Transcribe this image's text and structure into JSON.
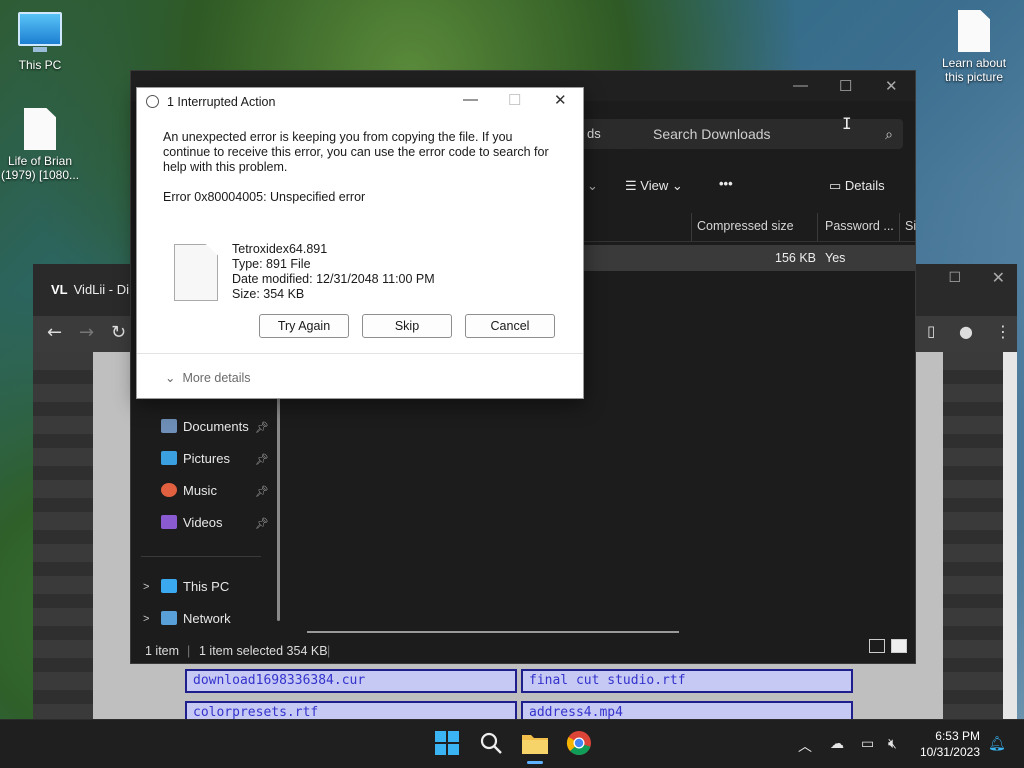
{
  "desktop": {
    "icons": [
      {
        "label": "This PC"
      },
      {
        "label": "Life of Brian (1979) [1080..."
      },
      {
        "label": "Learn about this picture"
      }
    ]
  },
  "explorer": {
    "address_fragment": "ds",
    "search_placeholder": "Search Downloads",
    "toolbar": {
      "view": "View",
      "more": "•••",
      "details": "Details"
    },
    "columns": [
      "Compressed size",
      "Password ...",
      "Si"
    ],
    "row": {
      "compressed_size": "156 KB",
      "password": "Yes"
    },
    "nav": [
      {
        "label": "Documents",
        "pinned": true
      },
      {
        "label": "Pictures",
        "pinned": true
      },
      {
        "label": "Music",
        "pinned": true
      },
      {
        "label": "Videos",
        "pinned": true
      },
      {
        "label": "This PC"
      },
      {
        "label": "Network"
      }
    ],
    "status": {
      "count": "1 item",
      "selected": "1 item selected  354 KB"
    }
  },
  "browser": {
    "tab_title": "VidLii - Di",
    "logo": "VL",
    "cells": [
      "download1698336384.cur",
      "final cut studio.rtf",
      "colorpresets.rtf",
      "address4.mp4"
    ]
  },
  "dialog": {
    "title": "1 Interrupted Action",
    "message": "An unexpected error is keeping you from copying the file. If you continue to receive this error, you can use the error code to search for help with this problem.",
    "error": "Error 0x80004005: Unspecified error",
    "file": {
      "name": "Tetroxidex64.891",
      "type": "Type: 891 File",
      "modified": "Date modified: 12/31/2048 11:00 PM",
      "size": "Size: 354 KB"
    },
    "buttons": {
      "try_again": "Try Again",
      "skip": "Skip",
      "cancel": "Cancel"
    },
    "more_details": "More details"
  },
  "taskbar": {
    "time": "6:53 PM",
    "date": "10/31/2023"
  }
}
